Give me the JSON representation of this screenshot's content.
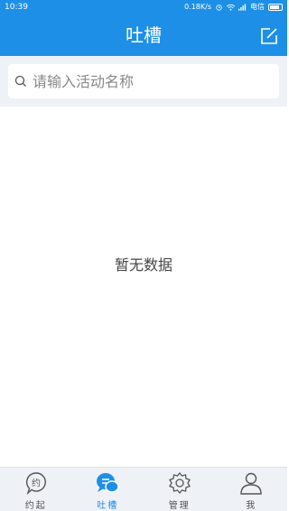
{
  "status_bar": {
    "time": "10:39",
    "speed": "0.18K/s",
    "carrier": "电信"
  },
  "app_bar": {
    "title": "吐槽",
    "edit_icon": "edit-square-icon"
  },
  "search": {
    "placeholder": "请输入活动名称",
    "icon": "search-icon"
  },
  "empty_state": {
    "text": "暂无数据"
  },
  "bottom_nav": {
    "items": [
      {
        "label": "约起",
        "icon": "yue-badge-icon",
        "active": false
      },
      {
        "label": "吐槽",
        "icon": "chat-bubble-icon",
        "active": true
      },
      {
        "label": "管理",
        "icon": "gear-icon",
        "active": false
      },
      {
        "label": "我",
        "icon": "person-icon",
        "active": false
      }
    ]
  },
  "colors": {
    "primary": "#1e8fe7",
    "background": "#ffffff",
    "search_bg": "#eef1f6",
    "nav_bg": "#eef1f6"
  }
}
